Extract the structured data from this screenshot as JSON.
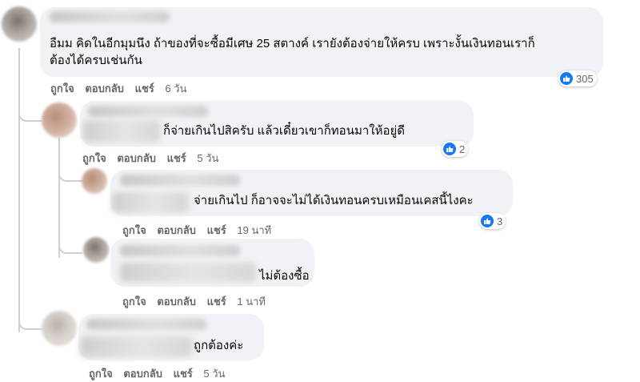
{
  "comments": [
    {
      "text_lines": [
        "อืมม คิดในอีกมุมนึง ถ้าของที่จะซื้อมีเศษ 25 สตางค์ เรายังต้องจ่ายให้ครบ เพราะงั้นเงินทอนเราก็",
        "ต้องได้ครบเช่นกัน"
      ],
      "like": "ถูกใจ",
      "reply": "ตอบกลับ",
      "share": "แชร์",
      "time": "6 วัน",
      "reactions": "305"
    },
    {
      "text_lines": [
        "ก็จ่ายเกินไปสิครับ แล้วเดี๋ยวเขาก็ทอนมาให้อยู่ดี"
      ],
      "like": "ถูกใจ",
      "reply": "ตอบกลับ",
      "share": "แชร์",
      "time": "5 วัน",
      "reactions": "2"
    },
    {
      "text_lines": [
        "จ่ายเกินไป ก็อาจจะไม่ได้เงินทอนครบเหมือนเคสนี้ไงคะ"
      ],
      "like": "ถูกใจ",
      "reply": "ตอบกลับ",
      "share": "แชร์",
      "time": "19 นาที",
      "reactions": "3"
    },
    {
      "text_lines": [
        "ไม่ต้องซื้อ"
      ],
      "like": "ถูกใจ",
      "reply": "ตอบกลับ",
      "share": "แชร์",
      "time": "1 นาที"
    },
    {
      "text_lines": [
        "ถูกต้องค่ะ"
      ],
      "like": "ถูกใจ",
      "reply": "ตอบกลับ",
      "share": "แชร์",
      "time": "5 วัน"
    }
  ],
  "colors": {
    "reaction_blue": "#1877f2",
    "bubble": "#f0f2f5",
    "meta_text": "#65676b"
  },
  "icons": {
    "reaction": "like-thumb-icon"
  }
}
